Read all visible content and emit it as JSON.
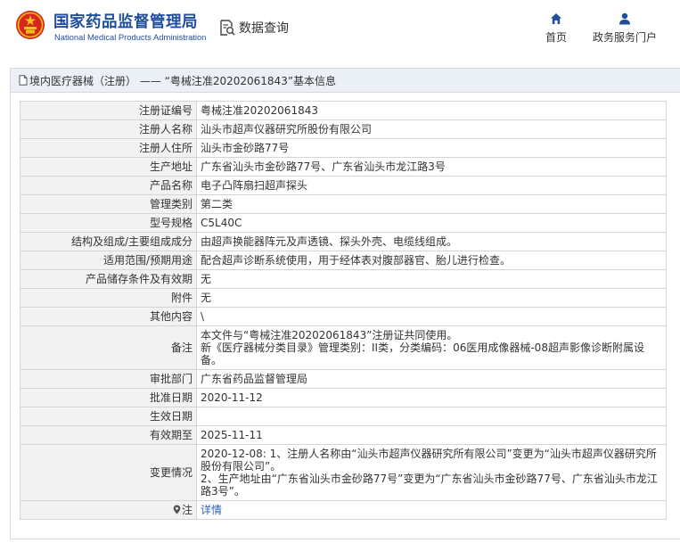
{
  "header": {
    "logo_cn": "国家药品监督管理局",
    "logo_en": "National Medical Products Administration",
    "search_label": "数据查询",
    "nav": [
      {
        "label": "首页",
        "icon": "home-icon"
      },
      {
        "label": "政务服务门户",
        "icon": "user-icon"
      }
    ]
  },
  "panel": {
    "title": "境内医疗器械（注册） —— “粤械注准20202061843”基本信息"
  },
  "rows": [
    {
      "key": "注册证编号",
      "value": "粤械注准20202061843"
    },
    {
      "key": "注册人名称",
      "value": "汕头市超声仪器研究所股份有限公司"
    },
    {
      "key": "注册人住所",
      "value": "汕头市金砂路77号"
    },
    {
      "key": "生产地址",
      "value": "广东省汕头市金砂路77号、广东省汕头市龙江路3号"
    },
    {
      "key": "产品名称",
      "value": "电子凸阵扇扫超声探头"
    },
    {
      "key": "管理类别",
      "value": "第二类"
    },
    {
      "key": "型号规格",
      "value": "C5L40C"
    },
    {
      "key": "结构及组成/主要组成成分",
      "value": "由超声换能器阵元及声透镜、探头外壳、电缆线组成。"
    },
    {
      "key": "适用范围/预期用途",
      "value": "配合超声诊断系统使用，用于经体表对腹部器官、胎儿进行检查。"
    },
    {
      "key": "产品储存条件及有效期",
      "value": "无"
    },
    {
      "key": "附件",
      "value": "无"
    },
    {
      "key": "其他内容",
      "value": "\\"
    },
    {
      "key": "备注",
      "value": "本文件与“粤械注准20202061843”注册证共同使用。\n新《医疗器械分类目录》管理类别：II类，分类编码：06医用成像器械-08超声影像诊断附属设备。"
    },
    {
      "key": "审批部门",
      "value": "广东省药品监督管理局"
    },
    {
      "key": "批准日期",
      "value": "2020-11-12"
    },
    {
      "key": "生效日期",
      "value": ""
    },
    {
      "key": "有效期至",
      "value": "2025-11-11"
    },
    {
      "key": "变更情况",
      "value": "2020-12-08: 1、注册人名称由“汕头市超声仪器研究所有限公司”变更为“汕头市超声仪器研究所股份有限公司”。\n2、生产地址由“广东省汕头市金砂路77号”变更为“广东省汕头市金砂路77号、广东省汕头市龙江路3号”。"
    }
  ],
  "note": {
    "key": "注",
    "link": "详情"
  },
  "colors": {
    "brand_blue": "#1f4e9c",
    "link_blue": "#2a62b5",
    "title_bar": "#eaf0f6",
    "emblem_red": "#d7261b",
    "emblem_gold": "#f2c21a"
  }
}
